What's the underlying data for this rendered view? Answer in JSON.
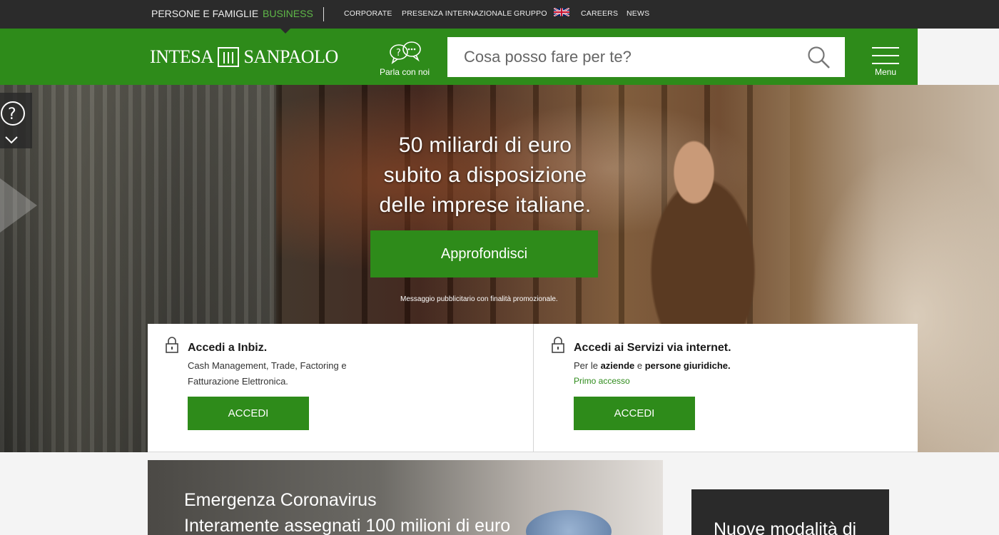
{
  "topbar": {
    "persone": "PERSONE E FAMIGLIE",
    "business": "BUSINESS",
    "corporate": "CORPORATE",
    "presenza": "PRESENZA INTERNAZIONALE",
    "gruppo": "GRUPPO",
    "careers": "CAREERS",
    "news": "NEWS"
  },
  "header": {
    "logo_left": "INTESA",
    "logo_right": "SANPAOLO",
    "chat_label": "Parla con noi",
    "search_placeholder": "Cosa posso fare per te?",
    "menu_label": "Menu"
  },
  "hero": {
    "line1": "50 miliardi di euro",
    "line2": "subito a disposizione",
    "line3": "delle imprese italiane.",
    "cta": "Approfondisci",
    "note": "Messaggio pubblicitario con finalità promozionale."
  },
  "panels": {
    "inbiz": {
      "title": "Accedi a Inbiz.",
      "desc": "Cash Management, Trade, Factoring e Fatturazione Elettronica.",
      "button": "ACCEDI"
    },
    "internet": {
      "title": "Accedi ai Servizi via internet.",
      "desc_prefix": "Per le ",
      "desc_bold1": "aziende",
      "desc_mid": " e ",
      "desc_bold2": "persone giuridiche.",
      "link": "Primo accesso",
      "button": "ACCEDI"
    }
  },
  "news": {
    "title": "Emergenza Coronavirus",
    "subtitle": "Interamente assegnati 100 milioni di euro"
  },
  "card": {
    "title": "Nuove modalità di"
  },
  "colors": {
    "brand_green": "#2e8b1a",
    "topbar_bg": "#2b2b2b",
    "active_tab": "#5fb848"
  }
}
